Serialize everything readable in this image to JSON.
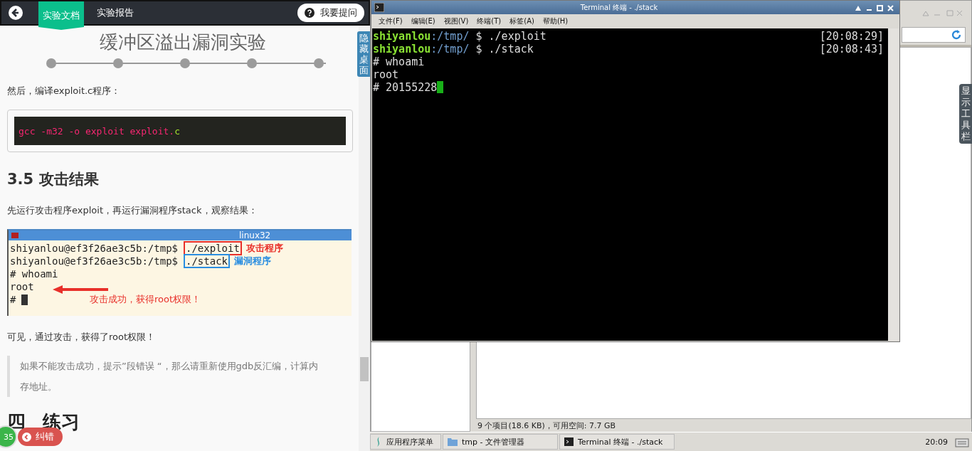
{
  "left_panel": {
    "nav": {
      "tabs": [
        {
          "label": "实验文档",
          "selected": true
        },
        {
          "label": "实验报告",
          "selected": false
        }
      ],
      "ask_button": "我要提问"
    },
    "hide_desktop_tab": "隐藏桌面",
    "doc": {
      "title": "缓冲区溢出漏洞实验",
      "paragraph_1": "然后，编译exploit.c程序：",
      "code": [
        {
          "text": "gcc -m32 -o exploit exploit.",
          "color": "#f92672"
        },
        {
          "text": "c",
          "color": "#a6e22e"
        }
      ],
      "section_heading": "3.5 攻击结果",
      "paragraph_2": "先运行攻击程序exploit，再运行漏洞程序stack，观察结果：",
      "screenshot": {
        "title": "linux32",
        "lines": [
          {
            "text": "shiyanlou@ef3f26ae3c5b:/tmp$",
            "command": "./exploit",
            "label": "攻击程序",
            "color": "#e8302a"
          },
          {
            "text": "shiyanlou@ef3f26ae3c5b:/tmp$",
            "command": "./stack",
            "label": "漏洞程序",
            "color": "#2a8ee0"
          },
          {
            "text": "# whoami"
          },
          {
            "text": "root"
          },
          {
            "text": "#",
            "cursor": true
          }
        ],
        "callout": "攻击成功，获得root权限！"
      },
      "paragraph_3": "可见，通过攻击，获得了root权限！",
      "note": "如果不能攻击成功，提示”段错误 “，那么请重新使用gdb反汇编，计算内存地址。",
      "next_heading": [
        "四",
        "练习"
      ]
    },
    "badge_count": "35",
    "report_button": "纠错"
  },
  "desktop": {
    "terminal": {
      "title": "Terminal 终端 - ./stack",
      "menu": [
        "文件(F)",
        "编辑(E)",
        "视图(V)",
        "终端(T)",
        "标签(A)",
        "帮助(H)"
      ],
      "lines": [
        {
          "kind": "prompt",
          "user": "shiyanlou",
          "path": ":/tmp/",
          "command": " $ ./exploit",
          "time": "[20:08:29]"
        },
        {
          "kind": "prompt",
          "user": "shiyanlou",
          "path": ":/tmp/",
          "command": " $ ./stack",
          "time": "[20:08:43]"
        },
        {
          "kind": "output",
          "text": "# whoami"
        },
        {
          "kind": "output",
          "text": "root"
        },
        {
          "kind": "output",
          "text": "# 20155228",
          "cursor": true
        }
      ]
    },
    "file_manager": {
      "status": "9 个项目(18.6 KB)，可用空间: 7.7 GB"
    },
    "show_toolbar_tab": "显示工具栏",
    "taskbar": {
      "menu_button": "应用程序菜单",
      "tasks": [
        {
          "label": "tmp - 文件管理器",
          "kind": "folder"
        },
        {
          "label": "Terminal 终端 - ./stack",
          "kind": "terminal"
        }
      ],
      "clock": "20:09"
    }
  }
}
